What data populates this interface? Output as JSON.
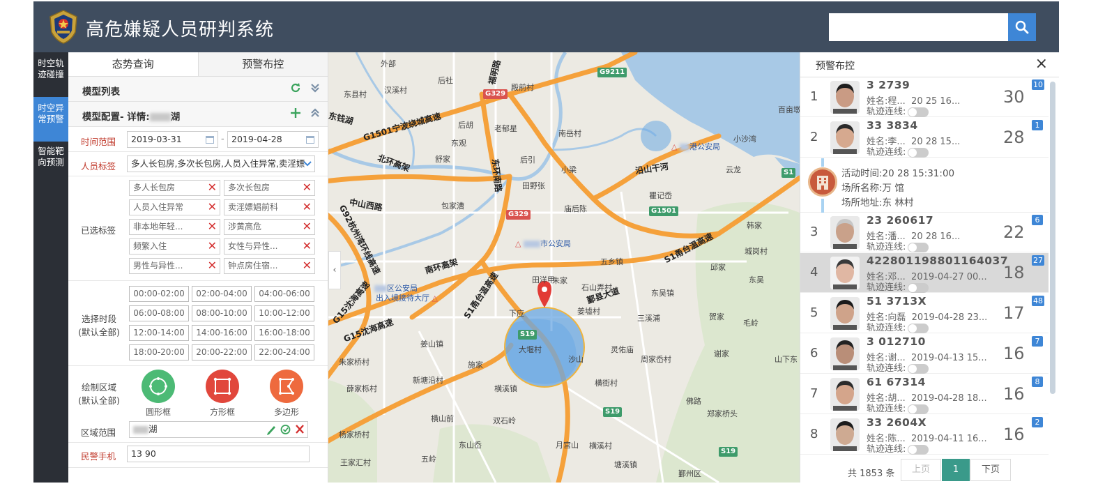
{
  "header": {
    "title": "高危嫌疑人员研判系统",
    "search": {
      "value": "",
      "placeholder": ""
    }
  },
  "sidenav": [
    {
      "label": "时空轨迹碰撞",
      "active": false
    },
    {
      "label": "时空异常预警",
      "active": true
    },
    {
      "label": "智能靶向预测",
      "active": false
    }
  ],
  "left": {
    "tabs": [
      "态势查询",
      "预警布控"
    ],
    "model_list": "模型列表",
    "model_config": "模型配置- 详情:",
    "model_config_name": "湖",
    "time_range_label": "时间范围",
    "date_start": "2019-03-31",
    "date_sep": "-",
    "date_end": "2019-04-28",
    "person_tag_label": "人员标签",
    "person_tag_value": "多人长包房,多次长包房,人员入住异常,卖淫嫖",
    "selected_tags_label": "已选标签",
    "selected_tags": [
      "多人长包房",
      "多次长包房",
      "人员入住异常",
      "卖淫嫖娼前科",
      "非本地年轻...",
      "涉黄高危",
      "频繁入住",
      "女性与异性...",
      "男性与异性...",
      "钟点房住宿..."
    ],
    "slots_label_1": "选择时段",
    "slots_label_2": "(默认全部)",
    "time_slots": [
      "00:00-02:00",
      "02:00-04:00",
      "04:00-06:00",
      "06:00-08:00",
      "08:00-10:00",
      "10:00-12:00",
      "12:00-14:00",
      "14:00-16:00",
      "16:00-18:00",
      "18:00-20:00",
      "20:00-22:00",
      "22:00-24:00"
    ],
    "draw_label_1": "绘制区域",
    "draw_label_2": "(默认全部)",
    "shapes": [
      "圆形框",
      "方形框",
      "多边形"
    ],
    "area_label": "区域范围",
    "area_value": "湖",
    "phone_label": "民警手机",
    "phone_value": "13          90"
  },
  "map": {
    "labels": [
      "外部",
      "后社",
      "东县村",
      "汉溪村",
      "殿前村",
      "后胡",
      "老郁星",
      "南岳村",
      "东观",
      "舒家",
      "后引",
      "田野张",
      "小梁",
      "包家漕",
      "庙后陈",
      "田洋甲",
      "朱家",
      "石山弄村",
      "东吴镇",
      "五乡镇",
      "下应",
      "姜墟村",
      "三溪浦",
      "贺家",
      "毛岭",
      "灵佑庙",
      "周家岙村",
      "谢家",
      "横街村",
      "新塘沿村",
      "施家",
      "横溪镇",
      "双石岭",
      "横山前",
      "东山岙",
      "月宫山",
      "五岭",
      "王家汇村",
      "塘溪镇",
      "鄞州区",
      "佛路",
      "沙山",
      "大堰村",
      "姜山镇",
      "横溪村",
      "薛家栎村",
      "朱家桥村",
      "杨家桥村",
      "郑家桥头",
      "瞿记岙",
      "邱家",
      "城岗村",
      "韩家",
      "百亩墩",
      "小沙湾",
      "山下东",
      "东吴",
      "云龙"
    ],
    "roads": [
      "G1501宁波绕城高速",
      "北环高架",
      "中山西路",
      "G92杭州湾环线高速",
      "南环高架",
      "S1甬台温高速",
      "G15沈海高速",
      "S1甬台温高速",
      "福明路",
      "东环南路",
      "G15沈海高速",
      "鄞县大道",
      "沿山干河",
      "东钱湖"
    ],
    "shields": [
      "G329",
      "G329",
      "G9211",
      "G1501",
      "S1",
      "S19",
      "S19",
      "S19"
    ],
    "pois": [
      "港公安局",
      "市公安局",
      "区公安局",
      "出入境接待大厅"
    ]
  },
  "right": {
    "title": "预警布控",
    "persons": [
      {
        "idx": "1",
        "id": "3            2739",
        "name": "姓名:程...",
        "time": "20       25 16...",
        "track": "轨迹连线:",
        "count": "30",
        "badge": "10"
      },
      {
        "idx": "2",
        "id": "33            3834",
        "name": "姓名:李...",
        "time": "20       28 15...",
        "track": "轨迹连线:",
        "count": "28",
        "badge": "1"
      },
      {
        "idx": "3",
        "id": "23            260617",
        "name": "姓名:潘...",
        "time": "20       28 16...",
        "track": "轨迹连线:",
        "count": "22",
        "badge": "6"
      },
      {
        "idx": "4",
        "id": "422801198801164037",
        "name": "姓名:邓...",
        "time": "2019-04-27 00...",
        "track": "轨迹连线:",
        "count": "18",
        "badge": "27"
      },
      {
        "idx": "5",
        "id": "51            3713X",
        "name": "姓名:向磊",
        "time": "2019-04-28 23...",
        "track": "轨迹连线:",
        "count": "17",
        "badge": "48"
      },
      {
        "idx": "6",
        "id": "3            012710",
        "name": "姓名:谢...",
        "time": "2019-04-13 15...",
        "track": "轨迹连线:",
        "count": "16",
        "badge": "7"
      },
      {
        "idx": "7",
        "id": "61            67314",
        "name": "姓名:胡...",
        "time": "2019-04-28 18...",
        "track": "轨迹连线:",
        "count": "16",
        "badge": "8"
      },
      {
        "idx": "8",
        "id": "33            2604X",
        "name": "姓名:陈...",
        "time": "2019-04-11 16...",
        "track": "轨迹连线:",
        "count": "16",
        "badge": "2"
      }
    ],
    "place": {
      "time": "活动时间:20       28 15:31:00",
      "name": "场所名称:万      馆",
      "addr": "场所地址:东         林村"
    },
    "pager": {
      "total": "共 1853 条",
      "prev": "上页",
      "page": "1",
      "next": "下页"
    }
  }
}
